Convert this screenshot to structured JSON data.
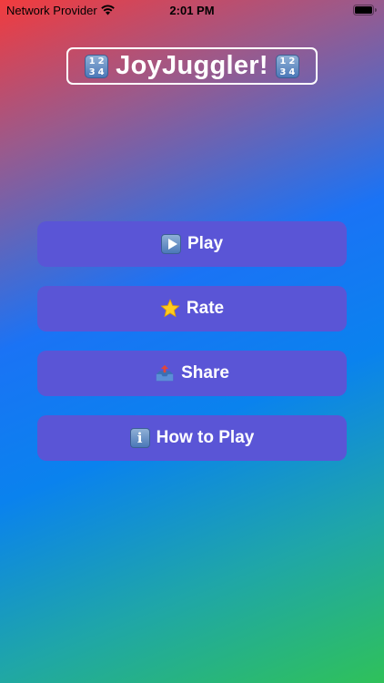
{
  "status_bar": {
    "carrier": "Network Provider",
    "time": "2:01 PM"
  },
  "title": {
    "text": "JoyJuggler!",
    "icon": "input-numbers-icon",
    "icon_digits": [
      "1",
      "2",
      "3",
      "4"
    ]
  },
  "menu": {
    "items": [
      {
        "label": "Play",
        "icon": "play-icon"
      },
      {
        "label": "Rate",
        "icon": "star-icon"
      },
      {
        "label": "Share",
        "icon": "outbox-tray-icon"
      },
      {
        "label": "How to Play",
        "icon": "info-icon"
      }
    ]
  },
  "colors": {
    "button_bg": "#5a55d6",
    "text": "#ffffff",
    "gradient_start": "#f23b3d",
    "gradient_mid": "#1a73f5",
    "gradient_end": "#2fc15a"
  }
}
